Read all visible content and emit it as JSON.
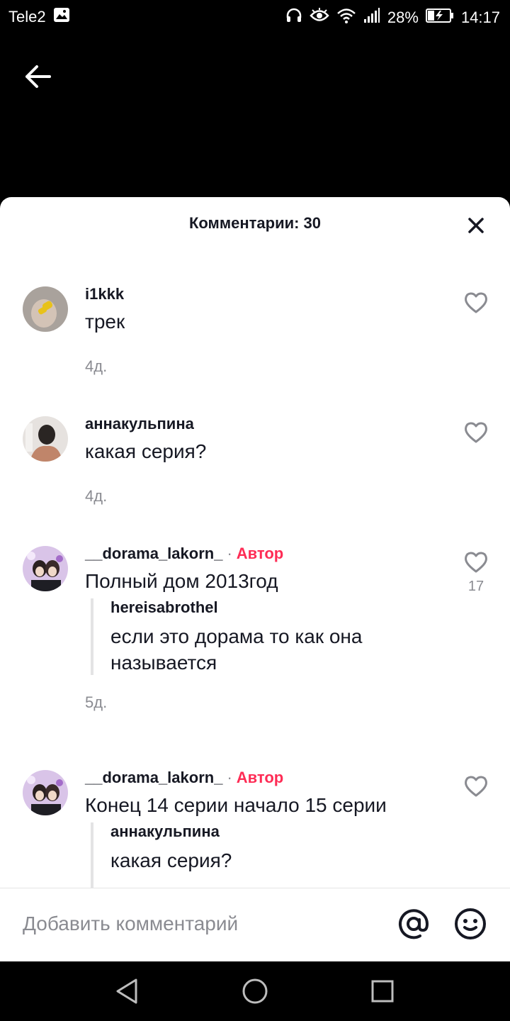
{
  "status": {
    "carrier": "Tele2",
    "battery": "28%",
    "time": "14:17"
  },
  "sheet": {
    "title": "Комментарии: 30"
  },
  "comments": [
    {
      "user": "i1kkk",
      "text": "трек",
      "time": "4д.",
      "is_author": false
    },
    {
      "user": "аннакульпина",
      "text": "какая серия?",
      "time": "4д.",
      "is_author": false
    },
    {
      "user": "__dorama_lakorn_",
      "author_label": "Автор",
      "separator": "·",
      "text": "Полный дом 2013год",
      "likes": "17",
      "time": "5д.",
      "is_author": true,
      "quote": {
        "user": "hereisabrothel",
        "text": "если это дорама то как она называется"
      }
    },
    {
      "user": "__dorama_lakorn_",
      "author_label": "Автор",
      "separator": "·",
      "text": "Конец 14 серии начало 15 серии",
      "is_author": true,
      "quote": {
        "user": "аннакульпина",
        "text": "какая серия?"
      }
    }
  ],
  "input": {
    "placeholder": "Добавить комментарий"
  },
  "colors": {
    "accent": "#fe2c55",
    "text": "#161823",
    "muted": "#8a8b91"
  }
}
